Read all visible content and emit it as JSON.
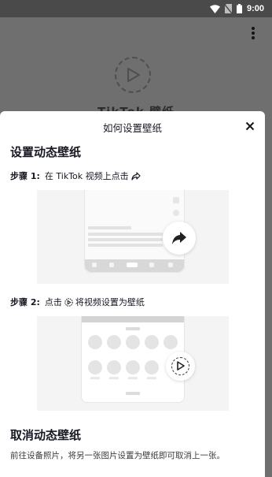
{
  "status_bar": {
    "time": "9:00",
    "icons": [
      "wifi-icon",
      "no-sim-icon",
      "battery-icon"
    ]
  },
  "background_page": {
    "title": "TikTok 壁纸",
    "menu_icon": "more-vertical-icon",
    "play_icon": "play-circle-icon"
  },
  "sheet": {
    "title": "如何设置壁纸",
    "close_icon": "close-icon",
    "section_live": {
      "heading": "设置动态壁纸",
      "step1": {
        "label": "步骤 1:",
        "before": "在 TikTok 视频上点击",
        "icon": "share-arrow-icon"
      },
      "step2": {
        "label": "步骤 2:",
        "before": "点击",
        "icon": "play-circle-icon",
        "after": "将视频设置为壁纸"
      }
    },
    "section_cancel": {
      "heading": "取消动态壁纸",
      "description": "前往设备照片，将另一张图片设置为壁纸即可取消上一张。"
    }
  },
  "colors": {
    "overlay": "#6f6f6f",
    "sheet_bg": "#ffffff",
    "text": "#161823",
    "illustration_bg": "#f4f4f5"
  }
}
